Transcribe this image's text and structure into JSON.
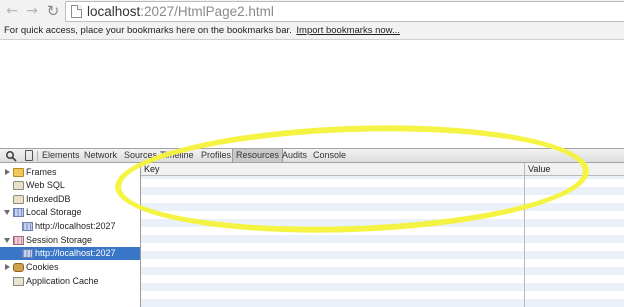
{
  "browser": {
    "url_host": "localhost",
    "url_path": ":2027/HtmlPage2.html",
    "nav": {
      "back_icon": "back-arrow-icon",
      "forward_icon": "forward-arrow-icon",
      "reload_icon": "reload-icon"
    }
  },
  "bookmarks_bar": {
    "message": "For quick access, place your bookmarks here on the bookmarks bar.",
    "import_link": "Import bookmarks now..."
  },
  "devtools": {
    "tabs": [
      "Elements",
      "Network",
      "Sources",
      "Timeline",
      "Profiles",
      "Resources",
      "Audits",
      "Console"
    ],
    "active_tab": "Resources",
    "sidebar": [
      {
        "label": "Frames",
        "icon": "folder-icon",
        "expander": "collapsed"
      },
      {
        "label": "Web SQL",
        "icon": "database-icon",
        "expander": "none"
      },
      {
        "label": "IndexedDB",
        "icon": "database-icon",
        "expander": "none"
      },
      {
        "label": "Local Storage",
        "icon": "storage-grid-icon",
        "expander": "expanded"
      },
      {
        "label": "http://localhost:2027",
        "icon": "storage-grid-icon",
        "expander": "none"
      },
      {
        "label": "Session Storage",
        "icon": "storage-grid-icon",
        "expander": "expanded"
      },
      {
        "label": "http://localhost:2027",
        "icon": "storage-grid-icon",
        "expander": "none",
        "selected": true
      },
      {
        "label": "Cookies",
        "icon": "cookie-icon",
        "expander": "collapsed"
      },
      {
        "label": "Application Cache",
        "icon": "cache-icon",
        "expander": "none"
      }
    ],
    "grid": {
      "columns": [
        "Key",
        "Value"
      ],
      "rows": []
    }
  },
  "colors": {
    "selection": "#3a76c7",
    "annotation": "#f4f23a",
    "row_stripe": "#eaf1fb"
  }
}
